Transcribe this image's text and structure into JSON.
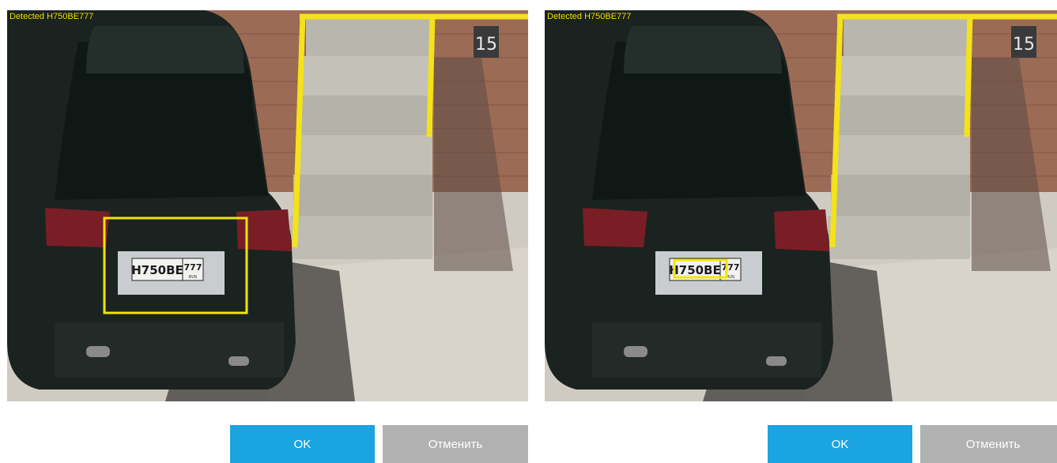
{
  "panels": [
    {
      "detection_label": "Detected H750BE777",
      "plate": {
        "main": "Н750ВЕ",
        "region": "777",
        "sub": "RUS"
      },
      "box_mode": "region",
      "ok_label": "OK",
      "cancel_label": "Отменить"
    },
    {
      "detection_label": "Detected H750BE777",
      "plate": {
        "main": "Н750ВЕ",
        "region": "777",
        "sub": "RUS"
      },
      "box_mode": "plate",
      "ok_label": "OK",
      "cancel_label": "Отменить"
    }
  ],
  "scene": {
    "building_number": "15"
  },
  "colors": {
    "detection_box": "#f2e500",
    "ok_button": "#1aa4e0",
    "cancel_button": "#b1b1b1",
    "overlay_text": "#f7e600"
  }
}
